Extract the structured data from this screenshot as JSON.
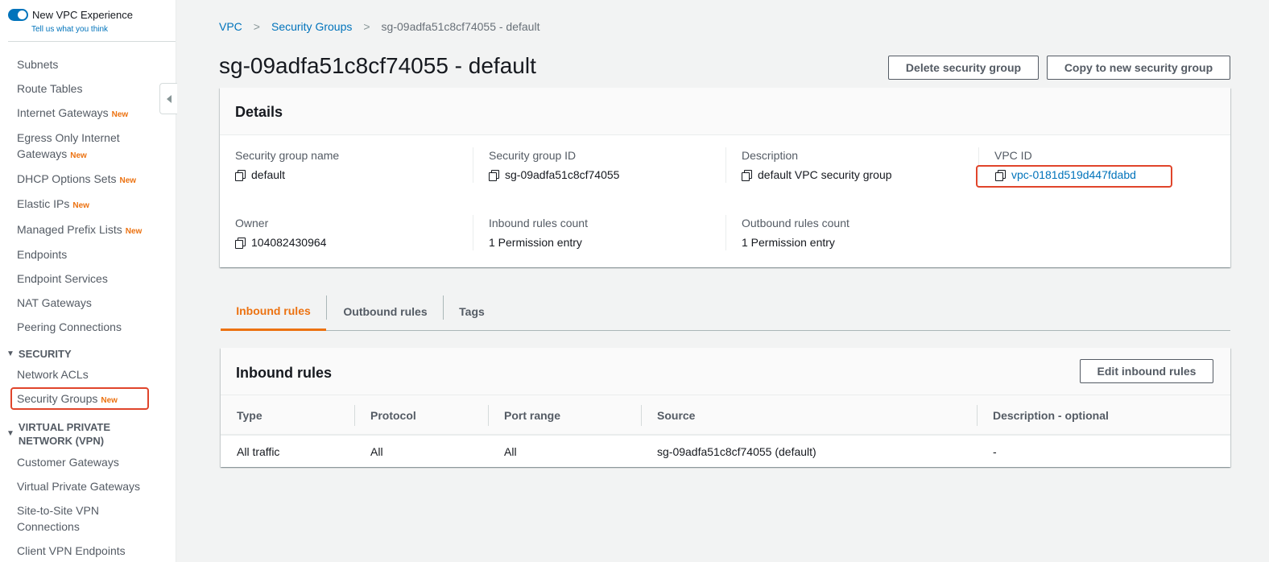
{
  "sidebar": {
    "toggle_label": "New VPC Experience",
    "feedback_link": "Tell us what you think",
    "new_tag": "New",
    "items": {
      "subnets": "Subnets",
      "route_tables": "Route Tables",
      "internet_gateways": "Internet Gateways",
      "egress_gateways_line1": "Egress Only Internet",
      "egress_gateways_line2": "Gateways",
      "dhcp_options": "DHCP Options Sets",
      "elastic_ips": "Elastic IPs",
      "managed_prefix_lists": "Managed Prefix Lists",
      "endpoints": "Endpoints",
      "endpoint_services": "Endpoint Services",
      "nat_gateways": "NAT Gateways",
      "peering_connections": "Peering Connections",
      "network_acls": "Network ACLs",
      "security_groups": "Security Groups",
      "customer_gateways": "Customer Gateways",
      "virtual_private_gateways": "Virtual Private Gateways",
      "site_to_site_line1": "Site-to-Site VPN",
      "site_to_site_line2": "Connections",
      "client_vpn_endpoints": "Client VPN Endpoints"
    },
    "sections": {
      "security": "SECURITY",
      "vpn_line1": "VIRTUAL PRIVATE",
      "vpn_line2": "NETWORK (VPN)"
    }
  },
  "breadcrumb": {
    "vpc": "VPC",
    "security_groups": "Security Groups",
    "current": "sg-09adfa51c8cf74055 - default"
  },
  "page_title": "sg-09adfa51c8cf74055 - default",
  "actions": {
    "delete": "Delete security group",
    "copy": "Copy to new security group"
  },
  "details": {
    "title": "Details",
    "fields": {
      "sg_name_label": "Security group name",
      "sg_name_value": "default",
      "sg_id_label": "Security group ID",
      "sg_id_value": "sg-09adfa51c8cf74055",
      "description_label": "Description",
      "description_value": "default VPC security group",
      "vpc_id_label": "VPC ID",
      "vpc_id_value": "vpc-0181d519d447fdabd",
      "owner_label": "Owner",
      "owner_value": "104082430964",
      "inbound_count_label": "Inbound rules count",
      "inbound_count_value": "1 Permission entry",
      "outbound_count_label": "Outbound rules count",
      "outbound_count_value": "1 Permission entry"
    }
  },
  "tabs": {
    "inbound": "Inbound rules",
    "outbound": "Outbound rules",
    "tags": "Tags"
  },
  "inbound_rules": {
    "title": "Inbound rules",
    "edit_button": "Edit inbound rules",
    "columns": {
      "type": "Type",
      "protocol": "Protocol",
      "port_range": "Port range",
      "source": "Source",
      "description": "Description - optional"
    },
    "rows": [
      {
        "type": "All traffic",
        "protocol": "All",
        "port_range": "All",
        "source": "sg-09adfa51c8cf74055 (default)",
        "description": "-"
      }
    ]
  },
  "colors": {
    "link": "#0073bb",
    "active_tab": "#ec7211",
    "highlight": "#e0452b",
    "new_tag": "#ec7211"
  }
}
